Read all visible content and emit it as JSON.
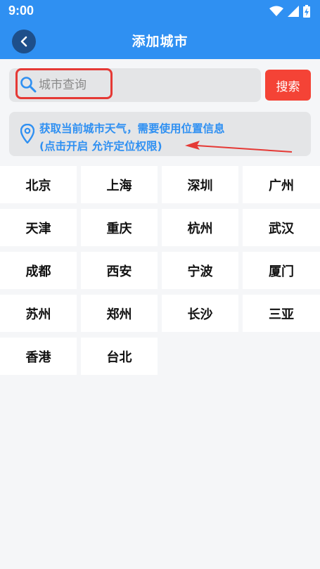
{
  "status_bar": {
    "time": "9:00"
  },
  "header": {
    "title": "添加城市"
  },
  "search": {
    "placeholder": "城市查询",
    "value": "",
    "button_label": "搜索"
  },
  "location": {
    "line1": "获取当前城市天气，需要使用位置信息",
    "line2": "(点击开启 允许定位权限)"
  },
  "cities": [
    "北京",
    "上海",
    "深圳",
    "广州",
    "天津",
    "重庆",
    "杭州",
    "武汉",
    "成都",
    "西安",
    "宁波",
    "厦门",
    "苏州",
    "郑州",
    "长沙",
    "三亚",
    "香港",
    "台北"
  ],
  "colors": {
    "primary": "#2f90f2",
    "danger": "#f44336",
    "highlight": "#e53935"
  }
}
